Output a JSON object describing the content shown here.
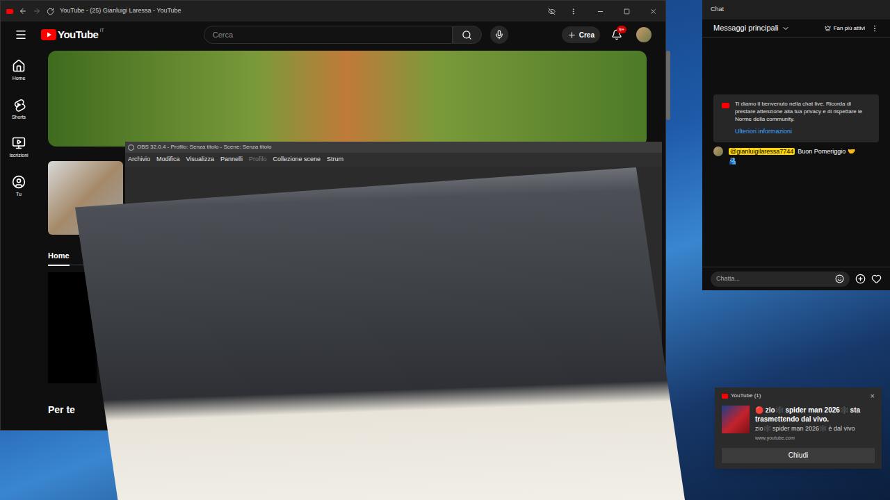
{
  "browser": {
    "title": "YouTube - (25) Gianluigi Laressa - YouTube",
    "logo": "YouTube",
    "region": "IT",
    "search": {
      "placeholder": "Cerca"
    },
    "create_button": "Crea",
    "notifications_badge": "9+",
    "sidebar": [
      {
        "label": "Home",
        "selected": false
      },
      {
        "label": "Shorts",
        "selected": false
      },
      {
        "label": "Iscrizioni",
        "selected": false
      },
      {
        "label": "Tu",
        "selected": false
      }
    ],
    "channel_tabs": [
      {
        "label": "Home",
        "selected": true
      }
    ],
    "section_title": "Per te"
  },
  "obs": {
    "title": "OBS 32.0.4 - Profilo: Senza titolo - Scene: Senza titolo",
    "menu": [
      {
        "label": "Archivio",
        "disabled": false
      },
      {
        "label": "Modifica",
        "disabled": false
      },
      {
        "label": "Visualizza",
        "disabled": false
      },
      {
        "label": "Pannelli",
        "disabled": false
      },
      {
        "label": "Profilo",
        "disabled": true
      },
      {
        "label": "Collezione scene",
        "disabled": false
      },
      {
        "label": "Strum",
        "disabled": false
      }
    ]
  },
  "chat": {
    "title": "Chat",
    "filter": "Messaggi principali",
    "top_fans_button": "Fan più attivi",
    "welcome": {
      "text": "Ti diamo il benvenuto nella chat live. Ricorda di prestare attenzione alla tua privacy e di rispettare le Norme della community.",
      "link": "Ulteriori informazioni"
    },
    "messages": [
      {
        "author": "@gianluigilaressa7744",
        "text": "Buon Pomeriggio 🤝🫂"
      }
    ],
    "input": {
      "placeholder": "Chatta..."
    }
  },
  "notification": {
    "app": "YouTube (1)",
    "close": "×",
    "title": "🔴 zio🕸️ spider man 2026🕸️ sta trasmettendo dal vivo.",
    "body": "zio🕸️ spider man 2026🕸️ è dal vivo",
    "source": "www.youtube.com",
    "button": "Chiudi"
  }
}
